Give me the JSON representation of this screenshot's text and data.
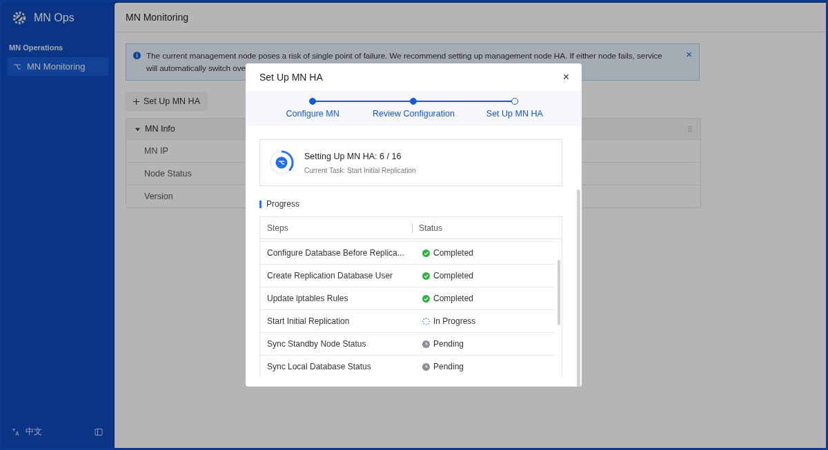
{
  "sidebar": {
    "app_name": "MN Ops",
    "section": "MN Operations",
    "items": [
      {
        "label": "MN Monitoring",
        "selected": true
      }
    ],
    "language": "中文"
  },
  "page": {
    "title": "MN Monitoring",
    "alert": {
      "lines": [
        "The current management node poses a risk of single point of failure. We recommend setting up management node HA. If either node fails, service",
        "will automatically switch ove"
      ],
      "close": "×"
    },
    "add_button": "Set Up MN HA",
    "info_panel": {
      "title": "MN Info",
      "expanded": true,
      "rows": [
        "MN IP",
        "Node Status",
        "Version"
      ]
    }
  },
  "dialog": {
    "title": "Set Up MN HA",
    "close": "×",
    "steps": [
      {
        "label": "Configure MN",
        "done": true
      },
      {
        "label": "Review Configuration",
        "done": true
      },
      {
        "label": "Set Up MN HA",
        "done": false
      }
    ],
    "summary": {
      "title": "Setting Up MN HA: 6 / 16",
      "subtitle": "Current Task: Start Initial Replication",
      "level": 0.375
    },
    "section_title": "Progress",
    "table": {
      "columns": [
        "Steps",
        "Status"
      ],
      "rows": [
        {
          "step": "Configure Database Before Replica...",
          "status": "Completed",
          "kind": "completed"
        },
        {
          "step": "Create Replication Database User",
          "status": "Completed",
          "kind": "completed"
        },
        {
          "step": "Update iptables Rules",
          "status": "Completed",
          "kind": "completed"
        },
        {
          "step": "Start Initial Replication",
          "status": "In Progress",
          "kind": "running"
        },
        {
          "step": "Sync Standby Node Status",
          "status": "Pending",
          "kind": "pending"
        },
        {
          "step": "Sync Local Database Status",
          "status": "Pending",
          "kind": "pending"
        }
      ]
    }
  }
}
